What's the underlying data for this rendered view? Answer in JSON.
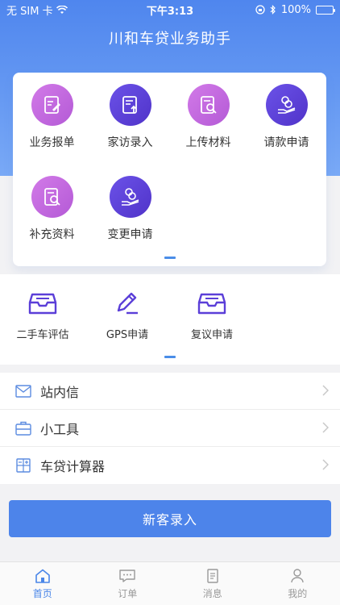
{
  "status_bar": {
    "carrier": "无 SIM 卡",
    "time": "下午3:13",
    "battery": "100%"
  },
  "app": {
    "title": "川和车贷业务助手"
  },
  "main_grid": {
    "items": [
      {
        "label": "业务报单",
        "icon": "report-form-icon"
      },
      {
        "label": "家访录入",
        "icon": "visit-upload-icon"
      },
      {
        "label": "上传材料",
        "icon": "upload-search-icon"
      },
      {
        "label": "请款申请",
        "icon": "coin-hand-icon"
      },
      {
        "label": "补充资料",
        "icon": "supplement-search-icon"
      },
      {
        "label": "变更申请",
        "icon": "coin-hand-icon"
      }
    ]
  },
  "tools_grid": {
    "items": [
      {
        "label": "二手车评估",
        "icon": "inbox-tray-icon"
      },
      {
        "label": "GPS申请",
        "icon": "pencil-icon"
      },
      {
        "label": "复议申请",
        "icon": "inbox-tray-icon"
      }
    ]
  },
  "list": {
    "items": [
      {
        "label": "站内信",
        "icon": "mail-icon"
      },
      {
        "label": "小工具",
        "icon": "toolbox-icon"
      },
      {
        "label": "车贷计算器",
        "icon": "calculator-icon"
      }
    ]
  },
  "cta": {
    "label": "新客录入"
  },
  "tabbar": {
    "items": [
      {
        "label": "首页",
        "icon": "home-icon",
        "active": true
      },
      {
        "label": "订单",
        "icon": "chat-icon",
        "active": false
      },
      {
        "label": "消息",
        "icon": "document-icon",
        "active": false
      },
      {
        "label": "我的",
        "icon": "person-icon",
        "active": false
      }
    ]
  },
  "colors": {
    "brand_blue": "#4d84ea",
    "icon_pink": "#c56ae0",
    "icon_purple": "#5b3fd8",
    "tool_icon": "#5b3fd8",
    "active_tab": "#4a86e8"
  }
}
